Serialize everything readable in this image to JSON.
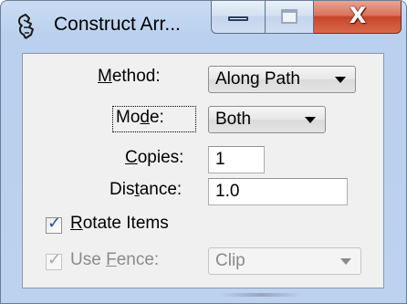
{
  "window": {
    "title": "Construct Arr...",
    "app_icon": "construct-array-tool-icon",
    "caption_buttons": {
      "minimize": "minimize-icon",
      "maximize": "maximize-icon",
      "close": "close-icon",
      "close_glyph": "X"
    },
    "accent_colors": {
      "frame": "#b9d0ee",
      "close_button": "#c7452a"
    }
  },
  "form": {
    "method": {
      "label_mnemonic": "M",
      "label_rest": "ethod:",
      "selected": "Along Path"
    },
    "mode": {
      "label_pre": "Mo",
      "label_mnemonic": "d",
      "label_rest": "e:",
      "selected": "Both"
    },
    "copies": {
      "label_mnemonic": "C",
      "label_rest": "opies:",
      "value": "1"
    },
    "distance": {
      "label_pre": "Dis",
      "label_mnemonic": "t",
      "label_rest": "ance:",
      "value": "1.0"
    },
    "rotate_items": {
      "checked": true,
      "label_mnemonic": "R",
      "label_rest": "otate Items"
    },
    "use_fence": {
      "checked": true,
      "enabled": false,
      "label_pre": "Use ",
      "label_mnemonic": "F",
      "label_rest": "ence:",
      "selected": "Clip"
    }
  }
}
